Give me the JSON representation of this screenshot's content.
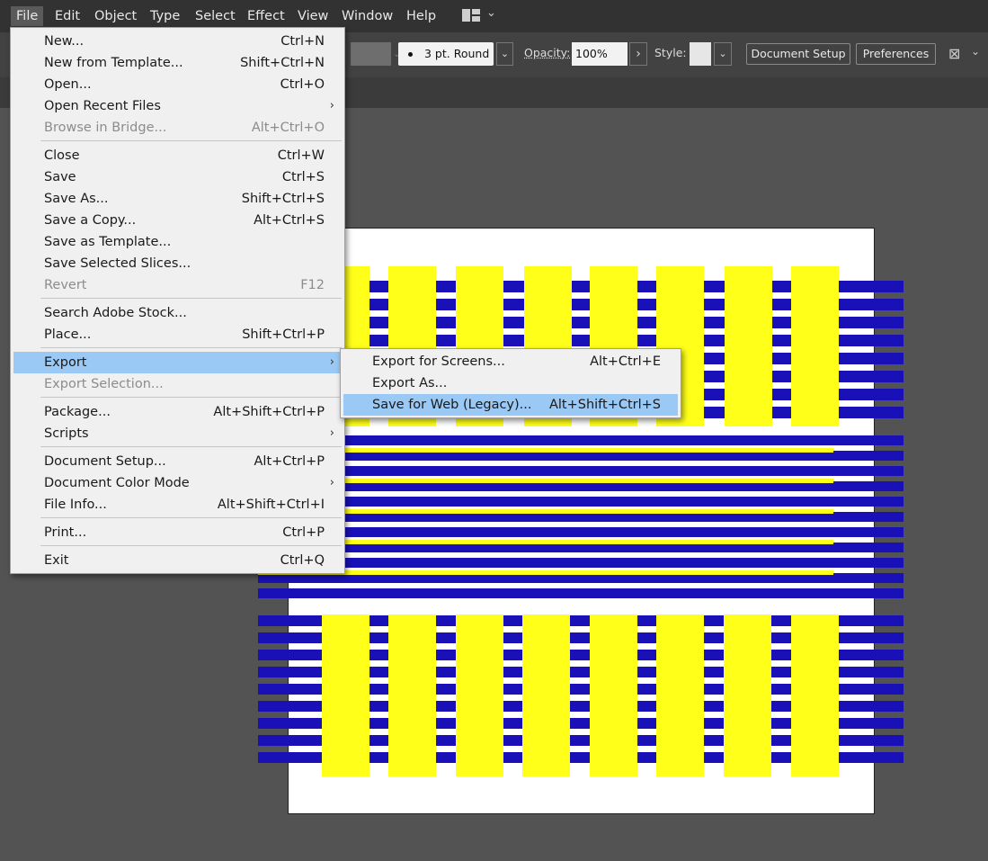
{
  "menubar": {
    "items": [
      "File",
      "Edit",
      "Object",
      "Type",
      "Select",
      "Effect",
      "View",
      "Window",
      "Help"
    ],
    "active": "File"
  },
  "controlbar": {
    "stroke_profile": "3 pt. Round",
    "opacity_label": "Opacity:",
    "opacity_value": "100%",
    "style_label": "Style:",
    "document_setup": "Document Setup",
    "preferences": "Preferences"
  },
  "file_menu": {
    "items": [
      {
        "label": "New...",
        "shortcut": "Ctrl+N"
      },
      {
        "label": "New from Template...",
        "shortcut": "Shift+Ctrl+N"
      },
      {
        "label": "Open...",
        "shortcut": "Ctrl+O"
      },
      {
        "label": "Open Recent Files",
        "submenu": true
      },
      {
        "label": "Browse in Bridge...",
        "shortcut": "Alt+Ctrl+O",
        "disabled": true
      },
      {
        "label": "Close",
        "shortcut": "Ctrl+W"
      },
      {
        "label": "Save",
        "shortcut": "Ctrl+S"
      },
      {
        "label": "Save As...",
        "shortcut": "Shift+Ctrl+S"
      },
      {
        "label": "Save a Copy...",
        "shortcut": "Alt+Ctrl+S"
      },
      {
        "label": "Save as Template..."
      },
      {
        "label": "Save Selected Slices..."
      },
      {
        "label": "Revert",
        "shortcut": "F12",
        "disabled": true
      },
      {
        "label": "Search Adobe Stock..."
      },
      {
        "label": "Place...",
        "shortcut": "Shift+Ctrl+P"
      },
      {
        "label": "Export",
        "submenu": true,
        "highlighted": true
      },
      {
        "label": "Export Selection...",
        "disabled": true
      },
      {
        "label": "Package...",
        "shortcut": "Alt+Shift+Ctrl+P"
      },
      {
        "label": "Scripts",
        "submenu": true
      },
      {
        "label": "Document Setup...",
        "shortcut": "Alt+Ctrl+P"
      },
      {
        "label": "Document Color Mode",
        "submenu": true
      },
      {
        "label": "File Info...",
        "shortcut": "Alt+Shift+Ctrl+I"
      },
      {
        "label": "Print...",
        "shortcut": "Ctrl+P"
      },
      {
        "label": "Exit",
        "shortcut": "Ctrl+Q"
      }
    ]
  },
  "export_submenu": {
    "items": [
      {
        "label": "Export for Screens...",
        "shortcut": "Alt+Ctrl+E"
      },
      {
        "label": "Export As..."
      },
      {
        "label": "Save for Web (Legacy)...",
        "shortcut": "Alt+Shift+Ctrl+S",
        "highlighted": true
      }
    ]
  },
  "colors": {
    "app_bg": "#535353",
    "menu_bg": "#f0f0f0",
    "highlight": "#99c9f4",
    "artwork_blue": "#1a10b8",
    "artwork_yellow": "#ffff1a"
  }
}
